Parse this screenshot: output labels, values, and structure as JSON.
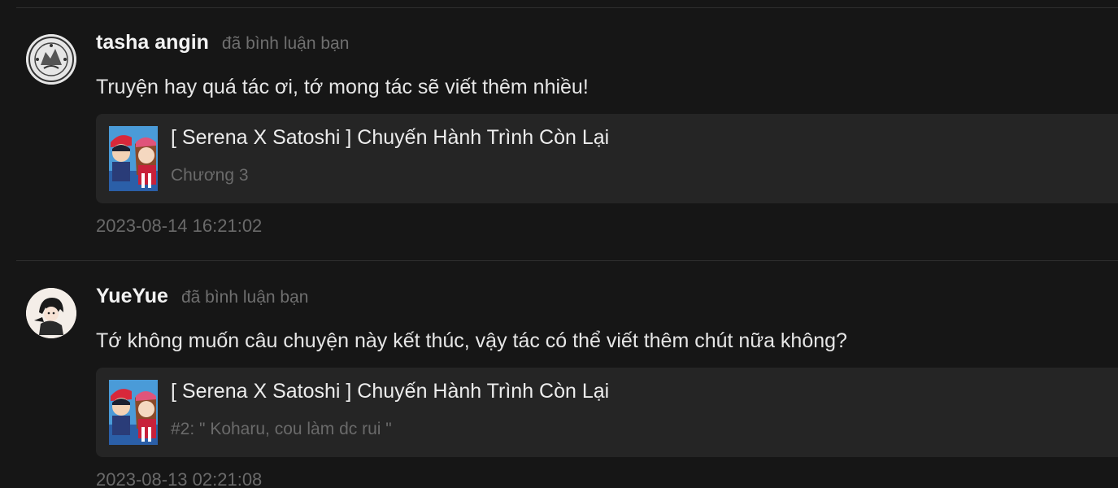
{
  "comments": [
    {
      "user_name": "tasha angin",
      "action": "đã bình luận bạn",
      "text": "Truyện hay quá tác ơi, tớ mong tác sẽ viết thêm nhiều!",
      "story_title": "[ Serena X Satoshi ] Chuyến Hành Trình Còn Lại",
      "story_sub": "Chương 3",
      "timestamp": "2023-08-14 16:21:02",
      "avatar_icon": "stamp-seal-avatar-icon"
    },
    {
      "user_name": "YueYue",
      "action": "đã bình luận bạn",
      "text": "Tớ không muốn câu chuyện này kết thúc, vậy tác có thể viết thêm chút nữa không?",
      "story_title": "[ Serena X Satoshi ] Chuyến Hành Trình Còn Lại",
      "story_sub": "#2: \" Koharu, cou làm dc rui \"",
      "timestamp": "2023-08-13 02:21:08",
      "avatar_icon": "anime-character-avatar-icon"
    }
  ],
  "colors": {
    "background": "#161616",
    "card": "#252525",
    "divider": "#2e2e2e",
    "text_primary": "#e6e6e6",
    "text_muted": "#6a6a6a"
  }
}
